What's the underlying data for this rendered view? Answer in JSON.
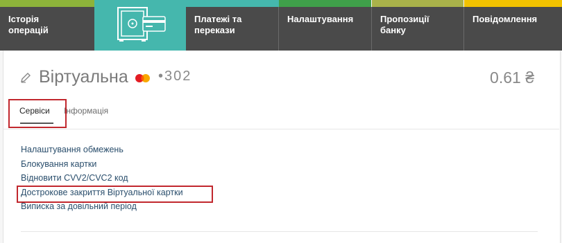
{
  "nav": {
    "tabs": [
      {
        "label": "Історія\nоперацій",
        "stripe": "#8db33a"
      },
      {
        "label": "",
        "active": true
      },
      {
        "label": "Платежі та\nперекази",
        "stripe": "#45b7ad"
      },
      {
        "label": "Налаштування",
        "stripe": "#3fa04a"
      },
      {
        "label": "Пропозиції\nбанку",
        "stripe": "#a9b24a"
      },
      {
        "label": "Повідомлення",
        "stripe": "#f2c200"
      }
    ]
  },
  "card": {
    "name": "Віртуальна",
    "number": "•302",
    "balance": "0.61 ₴"
  },
  "subtabs": {
    "services": "Сервіси",
    "info": "Інформація"
  },
  "services": [
    "Налаштування обмежень",
    "Блокування картки",
    "Відновити CVV2/CVC2 код",
    "Дострокове закриття Віртуальної картки",
    "Виписка за довільний період"
  ],
  "colors": {
    "accent": "#45b7ad",
    "highlight": "#c1272d",
    "nav_bg": "#4a4a4a"
  }
}
